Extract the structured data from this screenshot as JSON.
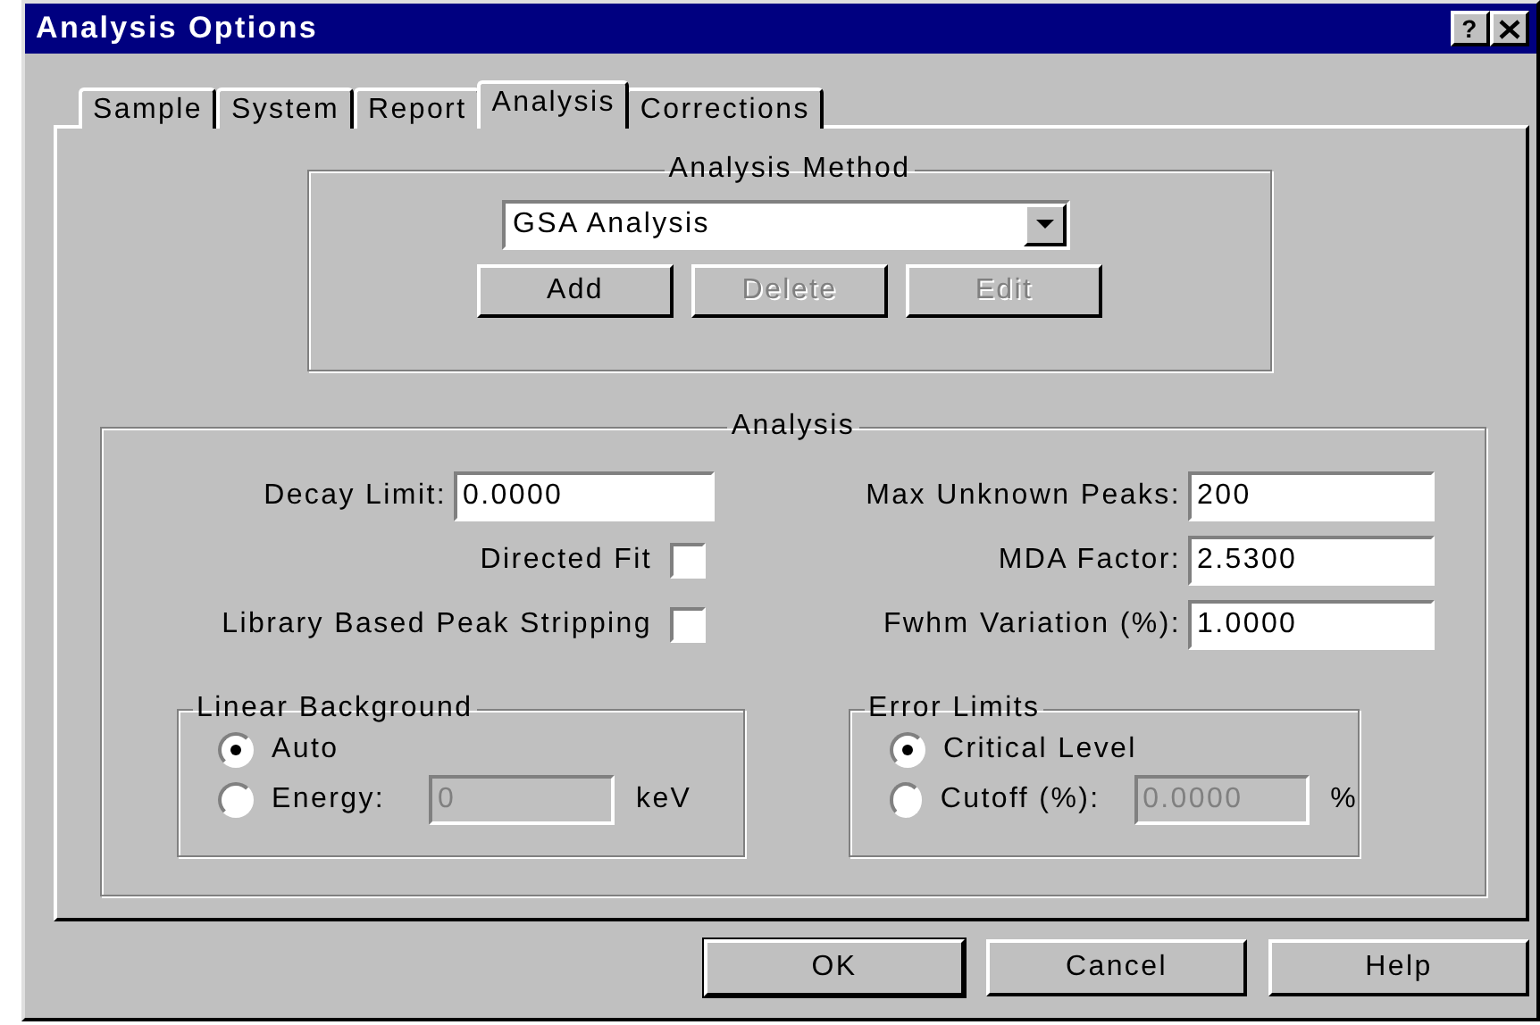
{
  "window": {
    "title": "Analysis Options",
    "help_button": "?"
  },
  "tabs": [
    {
      "label": "Sample",
      "selected": false
    },
    {
      "label": "System",
      "selected": false
    },
    {
      "label": "Report",
      "selected": false
    },
    {
      "label": "Analysis",
      "selected": true
    },
    {
      "label": "Corrections",
      "selected": false
    }
  ],
  "analysis_method": {
    "title": "Analysis Method",
    "dropdown": {
      "value": "GSA Analysis"
    },
    "buttons": [
      {
        "label": "Add",
        "disabled": false
      },
      {
        "label": "Delete",
        "disabled": true
      },
      {
        "label": "Edit",
        "disabled": true
      }
    ]
  },
  "analysis": {
    "title": "Analysis",
    "left_rows": [
      {
        "kind": "field",
        "label": "Decay Limit:",
        "value": "0.0000"
      },
      {
        "kind": "checkbox",
        "label": "Directed Fit",
        "checked": false
      },
      {
        "kind": "checkbox",
        "label": "Library Based Peak Stripping",
        "checked": false
      }
    ],
    "right_rows": [
      {
        "kind": "field",
        "label": "Max Unknown Peaks:",
        "value": "200"
      },
      {
        "kind": "field",
        "label": "MDA Factor:",
        "value": "2.5300"
      },
      {
        "kind": "field",
        "label": "Fwhm Variation (%):",
        "value": "1.0000"
      }
    ],
    "groups": [
      {
        "title": "Linear Background",
        "options": [
          {
            "label": "Auto",
            "selected": true
          },
          {
            "label": "Energy:",
            "selected": false,
            "field": {
              "value": "0",
              "disabled": true
            },
            "unit": "keV"
          }
        ]
      },
      {
        "title": "Error Limits",
        "options": [
          {
            "label": "Critical Level",
            "selected": true
          },
          {
            "label": "Cutoff (%):",
            "selected": false,
            "field": {
              "value": "0.0000",
              "disabled": true
            },
            "unit": "%"
          }
        ]
      }
    ]
  },
  "buttons": [
    {
      "label": "OK",
      "default": true
    },
    {
      "label": "Cancel",
      "default": false
    },
    {
      "label": "Help",
      "default": false
    }
  ]
}
